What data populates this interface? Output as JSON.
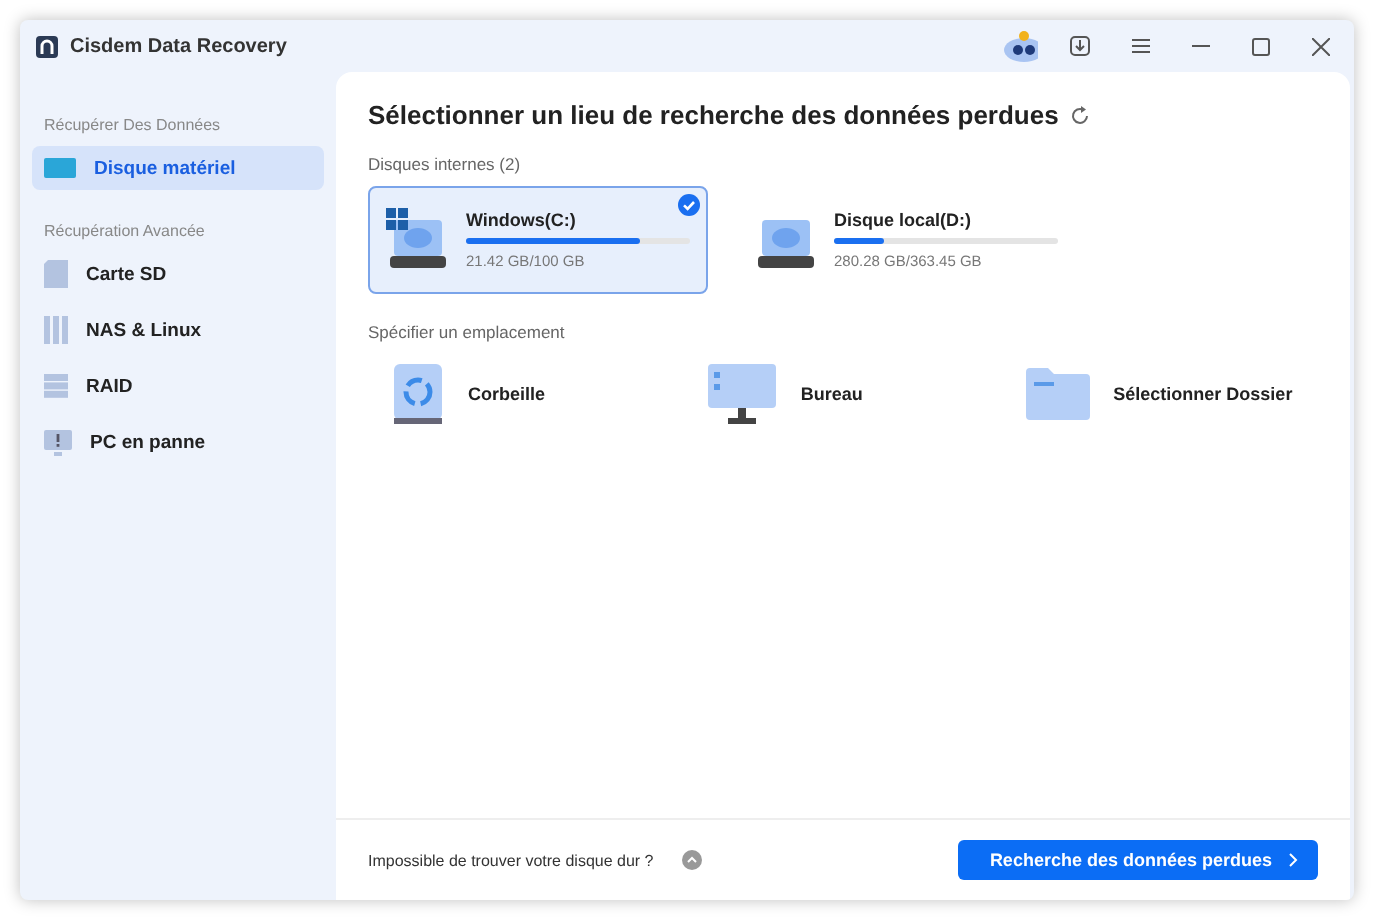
{
  "window": {
    "title": "Cisdem Data Recovery"
  },
  "sidebar": {
    "sections": [
      {
        "heading": "Récupérer Des Données",
        "items": [
          {
            "label": "Disque matériel",
            "kind": "disk",
            "selected": true
          }
        ]
      },
      {
        "heading": "Récupération Avancée",
        "items": [
          {
            "label": "Carte SD",
            "kind": "sd",
            "selected": false
          },
          {
            "label": "NAS & Linux",
            "kind": "nas",
            "selected": false
          },
          {
            "label": "RAID",
            "kind": "raid",
            "selected": false
          },
          {
            "label": "PC en panne",
            "kind": "pc",
            "selected": false
          }
        ]
      }
    ]
  },
  "main": {
    "title": "Sélectionner un lieu de recherche des données perdues",
    "internal": {
      "heading": "Disques internes (2)",
      "disks": [
        {
          "name": "Windows(C:)",
          "usage": "21.42 GB/100 GB",
          "level": 0.78,
          "system": true,
          "selected": true
        },
        {
          "name": "Disque local(D:)",
          "usage": "280.28 GB/363.45 GB",
          "level": 0.22,
          "system": false,
          "selected": false
        }
      ]
    },
    "locations": {
      "heading": "Spécifier un emplacement",
      "items": [
        {
          "label": "Corbeille",
          "kind": "trash"
        },
        {
          "label": "Bureau",
          "kind": "desktop"
        },
        {
          "label": "Sélectionner Dossier",
          "kind": "folder"
        }
      ]
    }
  },
  "footer": {
    "hint": "Impossible de trouver votre disque dur ?",
    "button": "Recherche des données perdues"
  }
}
